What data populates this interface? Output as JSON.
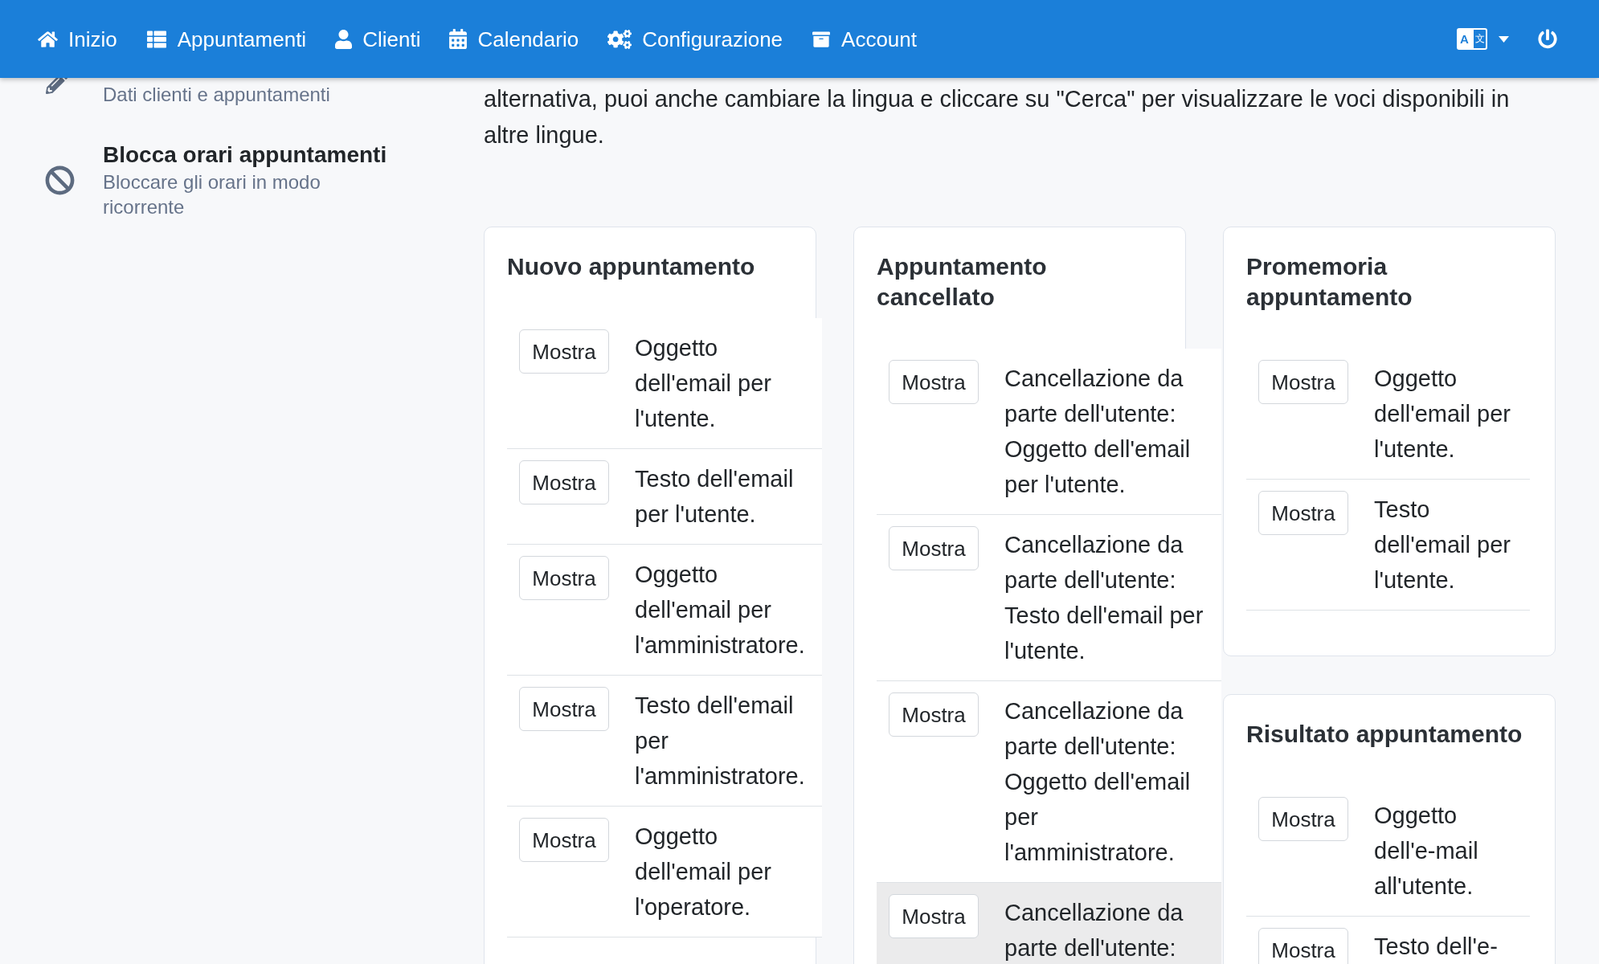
{
  "navbar": {
    "items": [
      "Inizio",
      "Appuntamenti",
      "Clienti",
      "Calendario",
      "Configurazione",
      "Account"
    ],
    "language_button": {
      "glyphs": [
        "A",
        "文"
      ]
    }
  },
  "sidebar": {
    "items": [
      {
        "description": "Dati clienti e appuntamenti"
      },
      {
        "title": "Blocca orari appuntamenti",
        "description": "Bloccare gli orari in modo ricorrente"
      }
    ]
  },
  "intro_text": "alternativa, puoi anche cambiare la lingua e cliccare su \"Cerca\" per visualizzare le voci disponibili in altre lingue.",
  "columns": [
    {
      "cards": [
        {
          "title": "Nuovo appuntamento",
          "rows": [
            {
              "button": "Mostra",
              "description": "Oggetto dell'email per l'utente.",
              "highlighted": false
            },
            {
              "button": "Mostra",
              "description": "Testo dell'email per l'utente.",
              "highlighted": false
            },
            {
              "button": "Mostra",
              "description": "Oggetto dell'email per l'amministratore.",
              "highlighted": false
            },
            {
              "button": "Mostra",
              "description": "Testo dell'email per l'amministratore.",
              "highlighted": false
            },
            {
              "button": "Mostra",
              "description": "Oggetto dell'email per l'operatore.",
              "highlighted": false
            }
          ]
        }
      ]
    },
    {
      "cards": [
        {
          "title": "Appuntamento cancellato",
          "rows": [
            {
              "button": "Mostra",
              "description": "Cancellazione da parte dell'utente: Oggetto dell'email per l'utente.",
              "highlighted": false
            },
            {
              "button": "Mostra",
              "description": "Cancellazione da parte dell'utente: Testo dell'email per l'utente.",
              "highlighted": false
            },
            {
              "button": "Mostra",
              "description": "Cancellazione da parte dell'utente: Oggetto dell'email per l'amministratore.",
              "highlighted": false
            },
            {
              "button": "Mostra",
              "description": "Cancellazione da parte dell'utente:",
              "highlighted": true
            }
          ]
        }
      ]
    },
    {
      "cards": [
        {
          "title": "Promemoria appuntamento",
          "rows": [
            {
              "button": "Mostra",
              "description": "Oggetto dell'email per l'utente.",
              "highlighted": false
            },
            {
              "button": "Mostra",
              "description": "Testo dell'email per l'utente.",
              "highlighted": false
            }
          ]
        },
        {
          "title": "Risultato appuntamento",
          "rows": [
            {
              "button": "Mostra",
              "description": "Oggetto dell'e-mail all'utente.",
              "highlighted": false
            },
            {
              "button": "Mostra",
              "description": "Testo dell'e-",
              "highlighted": false
            }
          ]
        }
      ]
    }
  ]
}
